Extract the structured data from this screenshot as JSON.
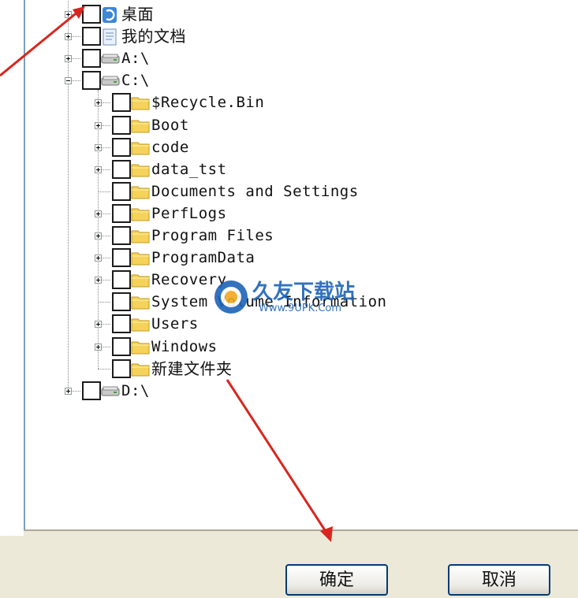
{
  "tree": {
    "nodes": [
      {
        "label": "桌面",
        "icon": "desktop-icon",
        "expander": "plus",
        "level": 0,
        "cjk": true
      },
      {
        "label": "我的文档",
        "icon": "documents-icon",
        "expander": "plus",
        "level": 0,
        "cjk": true
      },
      {
        "label": "A:\\",
        "icon": "drive-icon",
        "expander": "plus",
        "level": 0,
        "cjk": false
      },
      {
        "label": "C:\\",
        "icon": "drive-icon",
        "expander": "minus",
        "level": 0,
        "cjk": false
      },
      {
        "label": "$Recycle.Bin",
        "icon": "folder-icon",
        "expander": "plus",
        "level": 1,
        "cjk": false
      },
      {
        "label": "Boot",
        "icon": "folder-icon",
        "expander": "plus",
        "level": 1,
        "cjk": false
      },
      {
        "label": "code",
        "icon": "folder-icon",
        "expander": "plus",
        "level": 1,
        "cjk": false
      },
      {
        "label": "data_tst",
        "icon": "folder-icon",
        "expander": "plus",
        "level": 1,
        "cjk": false
      },
      {
        "label": "Documents and Settings",
        "icon": "folder-icon",
        "expander": "none",
        "level": 1,
        "cjk": false
      },
      {
        "label": "PerfLogs",
        "icon": "folder-icon",
        "expander": "plus",
        "level": 1,
        "cjk": false
      },
      {
        "label": "Program Files",
        "icon": "folder-icon",
        "expander": "plus",
        "level": 1,
        "cjk": false
      },
      {
        "label": "ProgramData",
        "icon": "folder-icon",
        "expander": "plus",
        "level": 1,
        "cjk": false
      },
      {
        "label": "Recovery",
        "icon": "folder-icon",
        "expander": "plus",
        "level": 1,
        "cjk": false
      },
      {
        "label": "System Volume Information",
        "icon": "folder-icon",
        "expander": "none",
        "level": 1,
        "cjk": false
      },
      {
        "label": "Users",
        "icon": "folder-icon",
        "expander": "plus",
        "level": 1,
        "cjk": false
      },
      {
        "label": "Windows",
        "icon": "folder-icon",
        "expander": "plus",
        "level": 1,
        "cjk": false
      },
      {
        "label": "新建文件夹",
        "icon": "folder-icon",
        "expander": "none",
        "level": 1,
        "cjk": true
      },
      {
        "label": "D:\\",
        "icon": "drive-icon",
        "expander": "plus",
        "level": 0,
        "cjk": false
      }
    ]
  },
  "buttons": {
    "ok_label": "确定",
    "cancel_label": "取消"
  },
  "watermark": {
    "name": "久友下载站",
    "url": "Www.9UPK.Com"
  },
  "colors": {
    "arrow": "#d8261f",
    "folder": "#f5d35b",
    "button_border": "#003c74"
  }
}
